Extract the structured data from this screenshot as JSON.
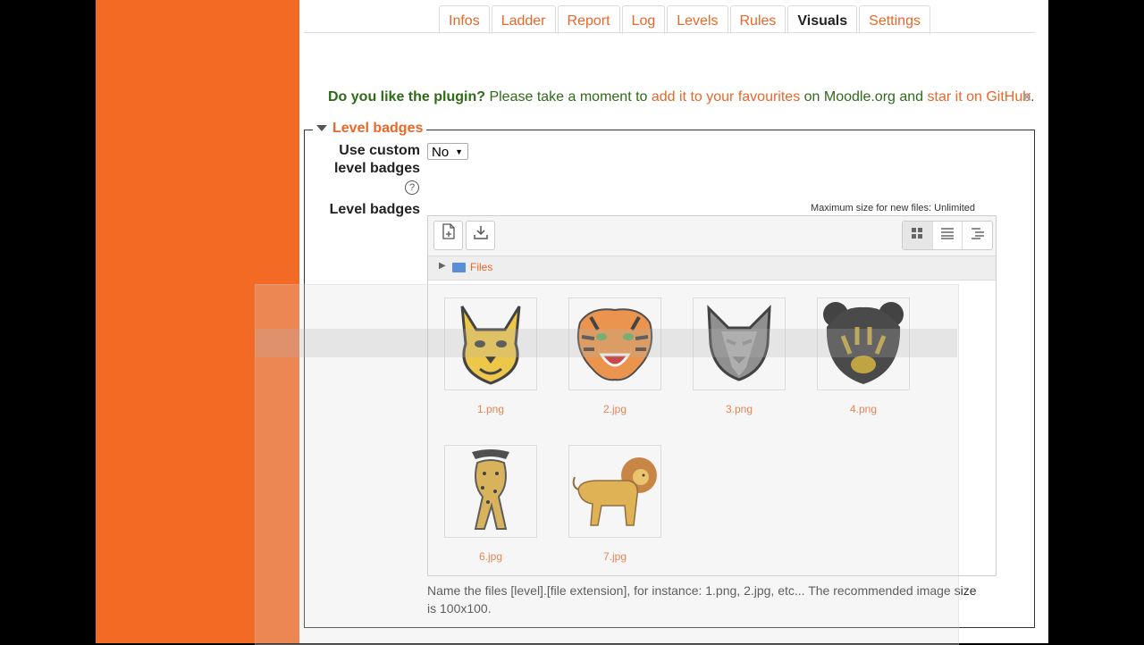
{
  "tabs": [
    {
      "label": "Infos",
      "active": false
    },
    {
      "label": "Ladder",
      "active": false
    },
    {
      "label": "Report",
      "active": false
    },
    {
      "label": "Log",
      "active": false
    },
    {
      "label": "Levels",
      "active": false
    },
    {
      "label": "Rules",
      "active": false
    },
    {
      "label": "Visuals",
      "active": true
    },
    {
      "label": "Settings",
      "active": false
    }
  ],
  "notice": {
    "question": "Do you like the plugin?",
    "text_a": " Please take a moment to ",
    "link_a": "add it to your favourites",
    "text_b": " on Moodle.org and ",
    "link_b": "star it on GitHub",
    "text_c": ".",
    "close": "×"
  },
  "section": {
    "legend": "Level badges",
    "use_custom_label_line1": "Use custom",
    "use_custom_label_line2": "level badges",
    "use_custom_value": "No",
    "level_badges_label": "Level badges",
    "help": "?"
  },
  "filemanager": {
    "max_size": "Maximum size for new files: Unlimited",
    "path": "Files",
    "files": [
      {
        "name": "1.png",
        "icon": "bobcat-icon"
      },
      {
        "name": "2.jpg",
        "icon": "tiger-icon"
      },
      {
        "name": "3.png",
        "icon": "wolf-icon"
      },
      {
        "name": "4.png",
        "icon": "bear-icon"
      },
      {
        "name": "6.jpg",
        "icon": "cheetah-icon"
      },
      {
        "name": "7.jpg",
        "icon": "lion-icon"
      }
    ]
  },
  "hint": "Name the files [level].[file extension], for instance: 1.png, 2.jpg, etc... The recommended image size is 100x100.",
  "colors": {
    "accent": "#e8672a",
    "sidebar": "#f26a24",
    "notice": "#2e6b18"
  }
}
